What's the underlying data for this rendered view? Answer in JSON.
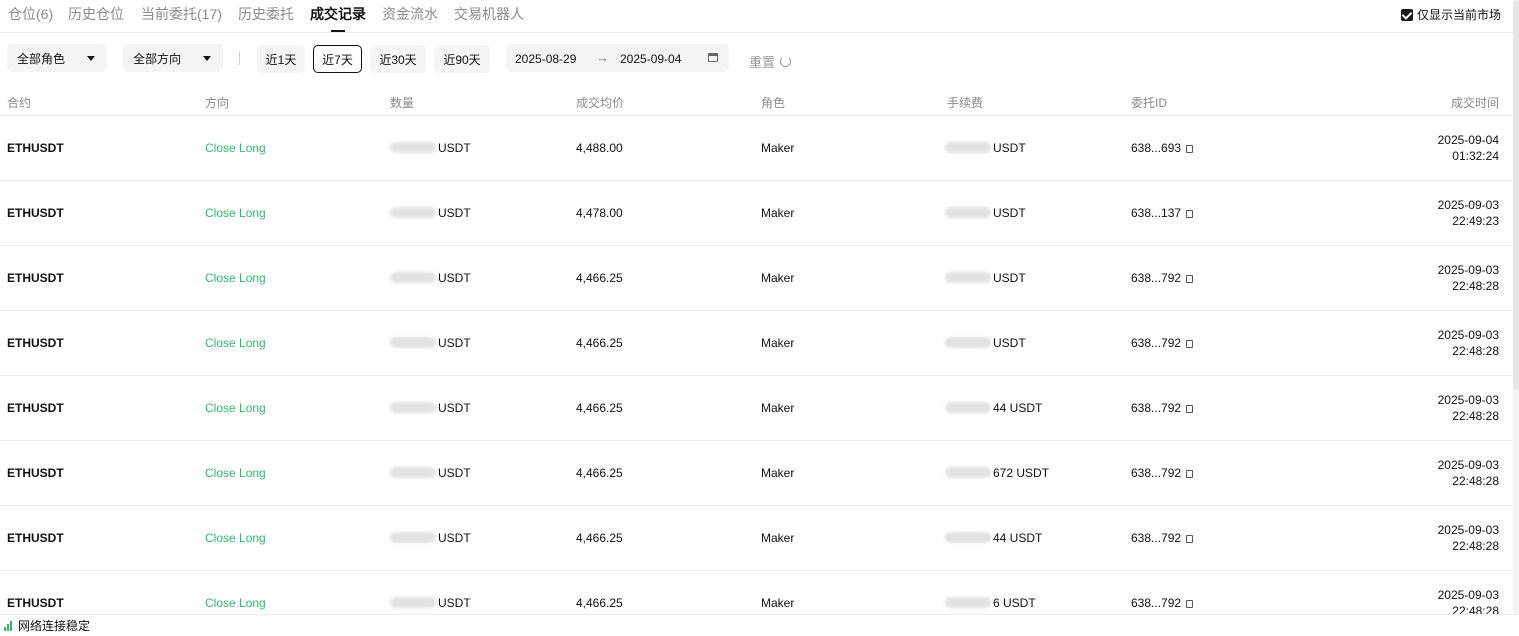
{
  "tabs": [
    {
      "label": "仓位(6)",
      "active": false
    },
    {
      "label": "历史仓位",
      "active": false
    },
    {
      "label": "当前委托(17)",
      "active": false
    },
    {
      "label": "历史委托",
      "active": false
    },
    {
      "label": "成交记录",
      "active": true
    },
    {
      "label": "资金流水",
      "active": false
    },
    {
      "label": "交易机器人",
      "active": false
    }
  ],
  "only_current_market": {
    "label": "仅显示当前市场",
    "checked": true
  },
  "filters": {
    "role": "全部角色",
    "direction": "全部方向",
    "ranges": [
      {
        "label": "近1天",
        "active": false
      },
      {
        "label": "近7天",
        "active": true
      },
      {
        "label": "近30天",
        "active": false
      },
      {
        "label": "近90天",
        "active": false
      }
    ],
    "date_from": "2025-08-29",
    "date_arrow": "→",
    "date_to": "2025-09-04",
    "reset": "重置"
  },
  "table": {
    "headers": {
      "contract": "合约",
      "direction": "方向",
      "quantity": "数量",
      "avg_price": "成交均价",
      "role": "角色",
      "fee": "手续费",
      "order_id": "委托ID",
      "time": "成交时间"
    },
    "rows": [
      {
        "contract": "ETHUSDT",
        "direction": "Close Long",
        "qty_suffix": "USDT",
        "price": "4,488.00",
        "role": "Maker",
        "fee_suffix": "USDT",
        "order_id": "638...693",
        "date": "2025-09-04",
        "time": "01:32:24"
      },
      {
        "contract": "ETHUSDT",
        "direction": "Close Long",
        "qty_suffix": "USDT",
        "price": "4,478.00",
        "role": "Maker",
        "fee_suffix": "USDT",
        "order_id": "638...137",
        "date": "2025-09-03",
        "time": "22:49:23"
      },
      {
        "contract": "ETHUSDT",
        "direction": "Close Long",
        "qty_suffix": "USDT",
        "price": "4,466.25",
        "role": "Maker",
        "fee_suffix": "USDT",
        "order_id": "638...792",
        "date": "2025-09-03",
        "time": "22:48:28"
      },
      {
        "contract": "ETHUSDT",
        "direction": "Close Long",
        "qty_suffix": "USDT",
        "price": "4,466.25",
        "role": "Maker",
        "fee_suffix": "USDT",
        "order_id": "638...792",
        "date": "2025-09-03",
        "time": "22:48:28"
      },
      {
        "contract": "ETHUSDT",
        "direction": "Close Long",
        "qty_suffix": "USDT",
        "price": "4,466.25",
        "role": "Maker",
        "fee_suffix": "44 USDT",
        "order_id": "638...792",
        "date": "2025-09-03",
        "time": "22:48:28"
      },
      {
        "contract": "ETHUSDT",
        "direction": "Close Long",
        "qty_suffix": "USDT",
        "price": "4,466.25",
        "role": "Maker",
        "fee_suffix": "672 USDT",
        "order_id": "638...792",
        "date": "2025-09-03",
        "time": "22:48:28"
      },
      {
        "contract": "ETHUSDT",
        "direction": "Close Long",
        "qty_suffix": "USDT",
        "price": "4,466.25",
        "role": "Maker",
        "fee_suffix": "44 USDT",
        "order_id": "638...792",
        "date": "2025-09-03",
        "time": "22:48:28"
      },
      {
        "contract": "ETHUSDT",
        "direction": "Close Long",
        "qty_suffix": "USDT",
        "price": "4,466.25",
        "role": "Maker",
        "fee_suffix": "6 USDT",
        "order_id": "638...792",
        "date": "2025-09-03",
        "time": "22:48:28"
      }
    ]
  },
  "status": {
    "network": "网络连接稳定",
    "icon": "signal-bars-icon"
  },
  "colors": {
    "green": "#2ebd6b",
    "muted": "#8a8a8a"
  }
}
